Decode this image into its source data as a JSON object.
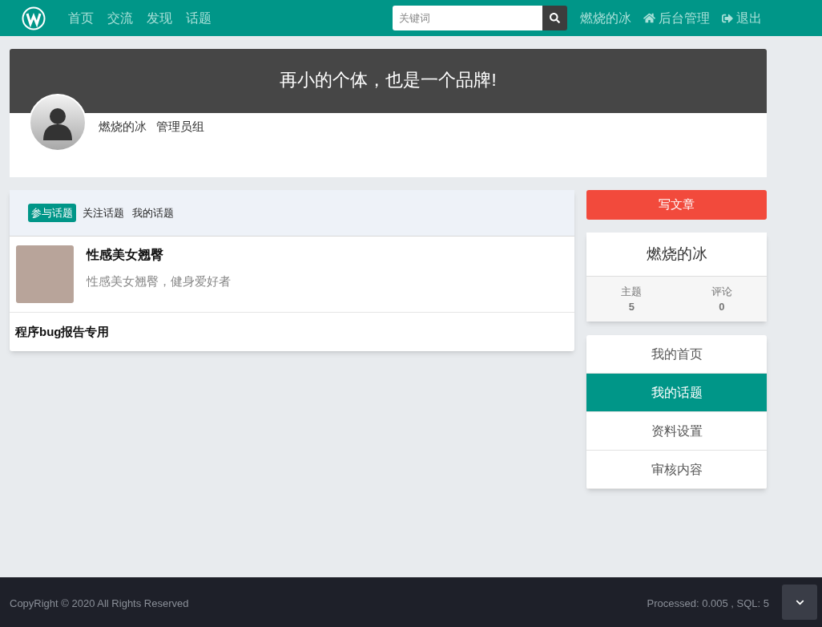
{
  "nav": {
    "links": [
      {
        "label": "首页"
      },
      {
        "label": "交流"
      },
      {
        "label": "发现"
      },
      {
        "label": "话题"
      }
    ],
    "search": {
      "placeholder": "关键词"
    },
    "user": "燃烧的冰",
    "admin": "后台管理",
    "logout": "退出"
  },
  "banner": {
    "slogan": "再小的个体，也是一个品牌!",
    "username": "燃烧的冰",
    "group": "管理员组"
  },
  "tabs": [
    {
      "label": "参与话题",
      "selected": true
    },
    {
      "label": "关注话题",
      "selected": false
    },
    {
      "label": "我的话题",
      "selected": false
    }
  ],
  "topics": [
    {
      "kind": "image",
      "title": "性感美女翘臀",
      "description": "性感美女翘臀，健身爱好者"
    },
    {
      "kind": "plain",
      "title": "程序bug报告专用"
    }
  ],
  "write_button": "写文章",
  "profile": {
    "name": "燃烧的冰",
    "stats": [
      {
        "label": "主题",
        "value": "5"
      },
      {
        "label": "评论",
        "value": "0"
      }
    ]
  },
  "menu": [
    {
      "label": "我的首页",
      "selected": false
    },
    {
      "label": "我的话题",
      "selected": true
    },
    {
      "label": "资料设置",
      "selected": false
    },
    {
      "label": "审核内容",
      "selected": false
    }
  ],
  "footer": {
    "copyright": "CopyRight © 2020 All Rights Reserved",
    "stats": "Processed: 0.005 , SQL: 5"
  }
}
